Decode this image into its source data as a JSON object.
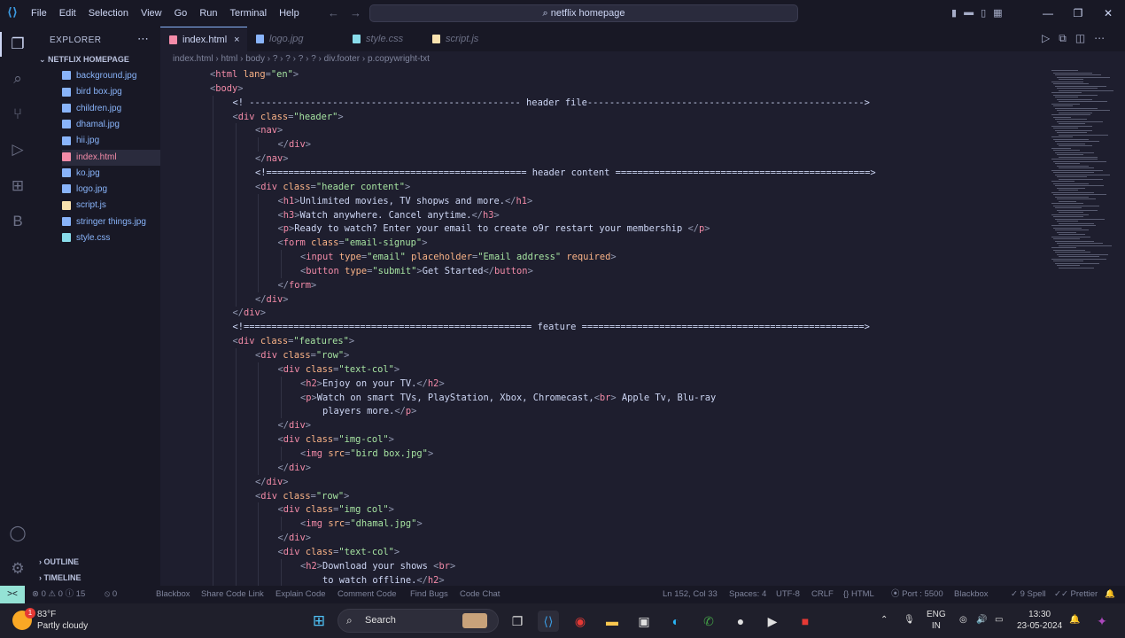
{
  "titlebar": {
    "menu": [
      "File",
      "Edit",
      "Selection",
      "View",
      "Go",
      "Run",
      "Terminal",
      "Help"
    ],
    "search": "netflix homepage"
  },
  "sidebar": {
    "title": "EXPLORER",
    "folder": "NETFLIX HOMEPAGE",
    "files": [
      {
        "name": "background.jpg",
        "type": "image"
      },
      {
        "name": "bird box.jpg",
        "type": "image"
      },
      {
        "name": "children.jpg",
        "type": "image"
      },
      {
        "name": "dhamal.jpg",
        "type": "image"
      },
      {
        "name": "hii.jpg",
        "type": "image"
      },
      {
        "name": "index.html",
        "type": "html",
        "active": true
      },
      {
        "name": "ko.jpg",
        "type": "image"
      },
      {
        "name": "logo.jpg",
        "type": "image"
      },
      {
        "name": "script.js",
        "type": "js"
      },
      {
        "name": "stringer things.jpg",
        "type": "image"
      },
      {
        "name": "style.css",
        "type": "css"
      }
    ],
    "outline": "OUTLINE",
    "timeline": "TIMELINE"
  },
  "tabs": [
    {
      "name": "index.html",
      "type": "html",
      "active": true,
      "close": "×"
    },
    {
      "name": "logo.jpg",
      "type": "image"
    },
    {
      "name": "style.css",
      "type": "css"
    },
    {
      "name": "script.js",
      "type": "js"
    }
  ],
  "breadcrumb": [
    "index.html",
    "html",
    "body",
    "?",
    "?",
    "?",
    "?",
    "div.footer",
    "p.copywright-txt"
  ],
  "code": [
    {
      "indent": 1,
      "text": "<html lang=\"en\">"
    },
    {
      "indent": 1,
      "text": "<body>"
    },
    {
      "indent": 2,
      "text": "<! ------------------------------------------------- header file-------------------------------------------------->"
    },
    {
      "indent": 2,
      "text": "<div class=\"header\">"
    },
    {
      "indent": 3,
      "text": "<nav>"
    },
    {
      "indent": 4,
      "text": "</div>"
    },
    {
      "indent": 3,
      "text": "</nav>"
    },
    {
      "indent": 3,
      "text": "<!=============================================== header content ==============================================>"
    },
    {
      "indent": 3,
      "text": "<div class=\"header content\">"
    },
    {
      "indent": 4,
      "text": "<h1>Unlimited movies, TV shopws and more.</h1>"
    },
    {
      "indent": 4,
      "text": "<h3>Watch anywhere. Cancel anytime.</h3>"
    },
    {
      "indent": 4,
      "text": "<p>Ready to watch? Enter your email to create o9r restart your membership </p>"
    },
    {
      "indent": 4,
      "text": "<form class=\"email-signup\">"
    },
    {
      "indent": 5,
      "text": "<input type=\"email\" placeholder=\"Email address\" required>"
    },
    {
      "indent": 5,
      "text": "<button type=\"submit\">Get Started</button>"
    },
    {
      "indent": 4,
      "text": "</form>"
    },
    {
      "indent": 3,
      "text": "</div>"
    },
    {
      "indent": 2,
      "text": "</div>"
    },
    {
      "indent": 2,
      "text": "<!==================================================== feature ===================================================>"
    },
    {
      "indent": 2,
      "text": "<div class=\"features\">"
    },
    {
      "indent": 3,
      "text": "<div class=\"row\">"
    },
    {
      "indent": 4,
      "text": "<div class=\"text-col\">"
    },
    {
      "indent": 5,
      "text": "<h2>Enjoy on your TV.</h2>"
    },
    {
      "indent": 5,
      "text": "<p>Watch on smart TVs, PlayStation, Xbox, Chromecast,<br> Apple Tv, Blu-ray"
    },
    {
      "indent": 5,
      "text": "    players more.</p>"
    },
    {
      "indent": 4,
      "text": "</div>"
    },
    {
      "indent": 4,
      "text": "<div class=\"img-col\">"
    },
    {
      "indent": 5,
      "text": "<img src=\"bird box.jpg\">"
    },
    {
      "indent": 4,
      "text": "</div>"
    },
    {
      "indent": 3,
      "text": "</div>"
    },
    {
      "indent": 3,
      "text": "<div class=\"row\">"
    },
    {
      "indent": 4,
      "text": "<div class=\"img col\">"
    },
    {
      "indent": 5,
      "text": "<img src=\"dhamal.jpg\">"
    },
    {
      "indent": 4,
      "text": "</div>"
    },
    {
      "indent": 4,
      "text": "<div class=\"text-col\">"
    },
    {
      "indent": 5,
      "text": "<h2>Download your shows <br>"
    },
    {
      "indent": 5,
      "text": "    to watch offline.</h2>"
    }
  ],
  "status": {
    "remote": "><",
    "problems": "⊗ 0  ⚠ 0  ⓘ 15",
    "ports": "⦸ 0",
    "blackbox": "Blackbox",
    "share": "Share Code Link",
    "explain": "Explain Code",
    "comment": "Comment Code",
    "bugs": "Find Bugs",
    "chat": "Code Chat",
    "position": "Ln 152, Col 33",
    "spaces": "Spaces: 4",
    "encoding": "UTF-8",
    "eol": "CRLF",
    "language": "{} HTML",
    "port": "⦿ Port : 5500",
    "blackbox2": "Blackbox",
    "spell": "✓ 9 Spell",
    "prettier": "✓✓ Prettier"
  },
  "taskbar": {
    "temp": "83°F",
    "weather": "Partly cloudy",
    "badge": "1",
    "search": "Search",
    "lang": "ENG",
    "region": "IN",
    "time": "13:30",
    "date": "23-05-2024"
  },
  "colors": {
    "bg": "#1e1e2e",
    "tag": "#f38ba8",
    "attr": "#fab387",
    "string": "#a6e3a1",
    "text": "#cdd6f4",
    "comment": "#cdd6f4"
  }
}
